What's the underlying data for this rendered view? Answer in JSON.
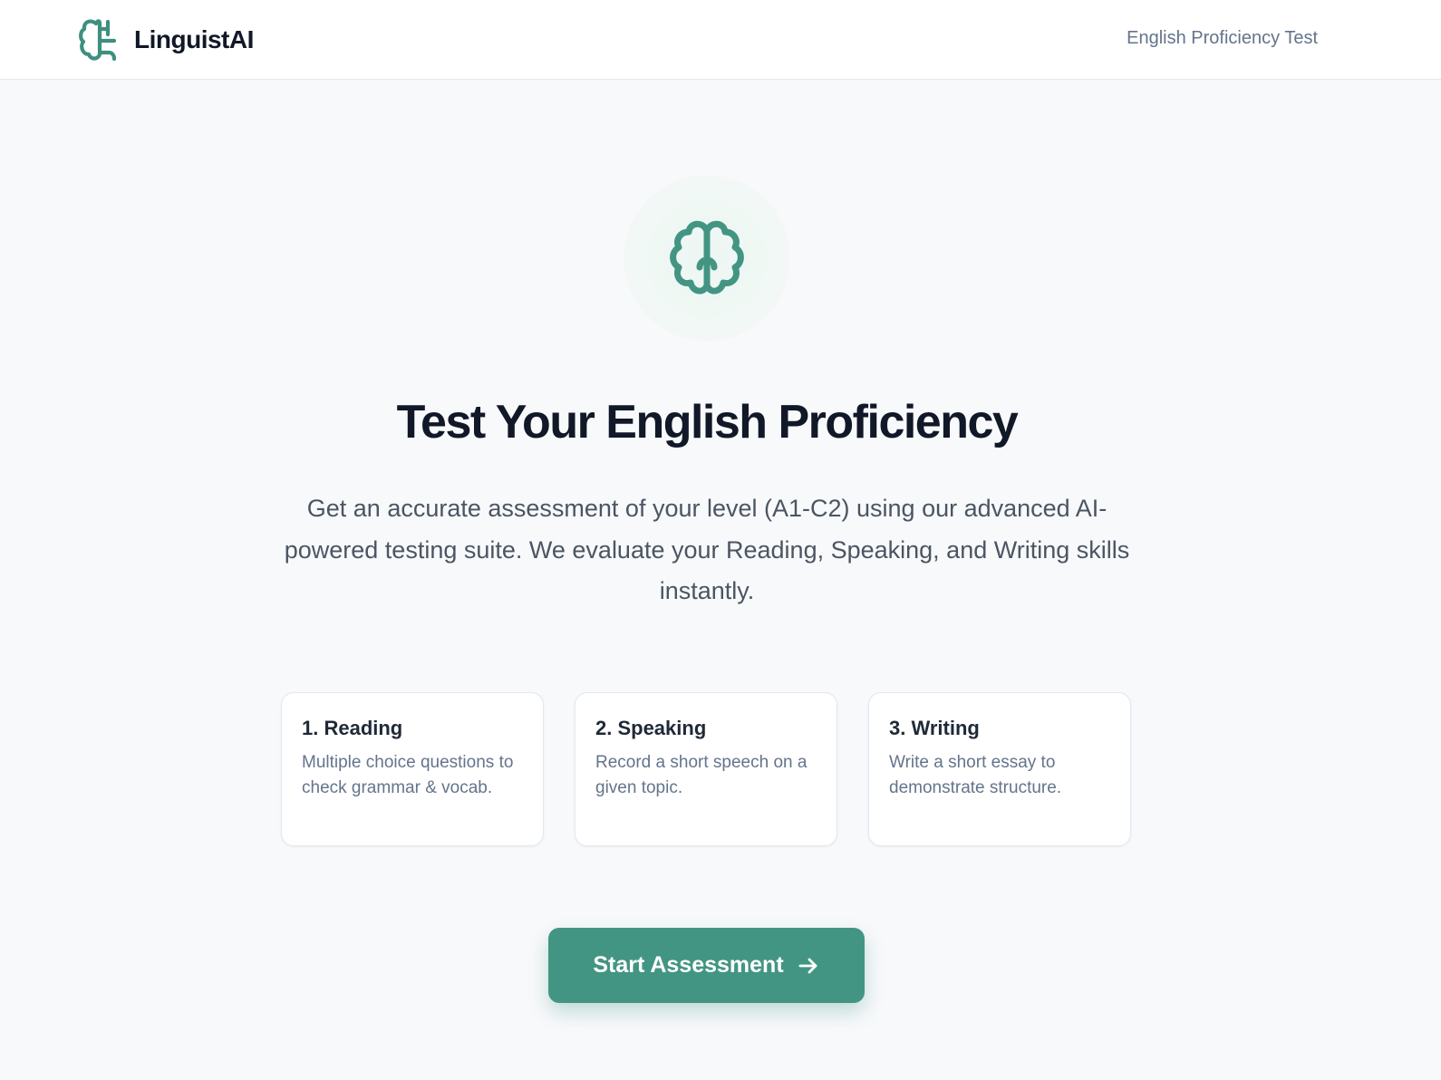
{
  "app": {
    "name": "LinguistAI",
    "logo_icon": "brain-icon"
  },
  "header": {
    "nav_link": "English Proficiency Test"
  },
  "hero": {
    "icon": "brain-icon",
    "title": "Test Your English Proficiency",
    "subtitle": "Get an accurate assessment of your level (A1-C2) using our advanced AI-powered testing suite. We evaluate your Reading, Speaking, and Writing skills instantly."
  },
  "sections": [
    {
      "title": "1. Reading",
      "description": "Multiple choice questions to check grammar & vocab."
    },
    {
      "title": "2. Speaking",
      "description": "Record a short speech on a given topic."
    },
    {
      "title": "3. Writing",
      "description": "Write a short essay to demonstrate structure."
    }
  ],
  "cta": {
    "label": "Start Assessment",
    "icon": "arrow-right-icon"
  },
  "colors": {
    "accent": "#439583",
    "background": "#f8f9fb",
    "title": "#111827",
    "muted": "#64748b"
  }
}
